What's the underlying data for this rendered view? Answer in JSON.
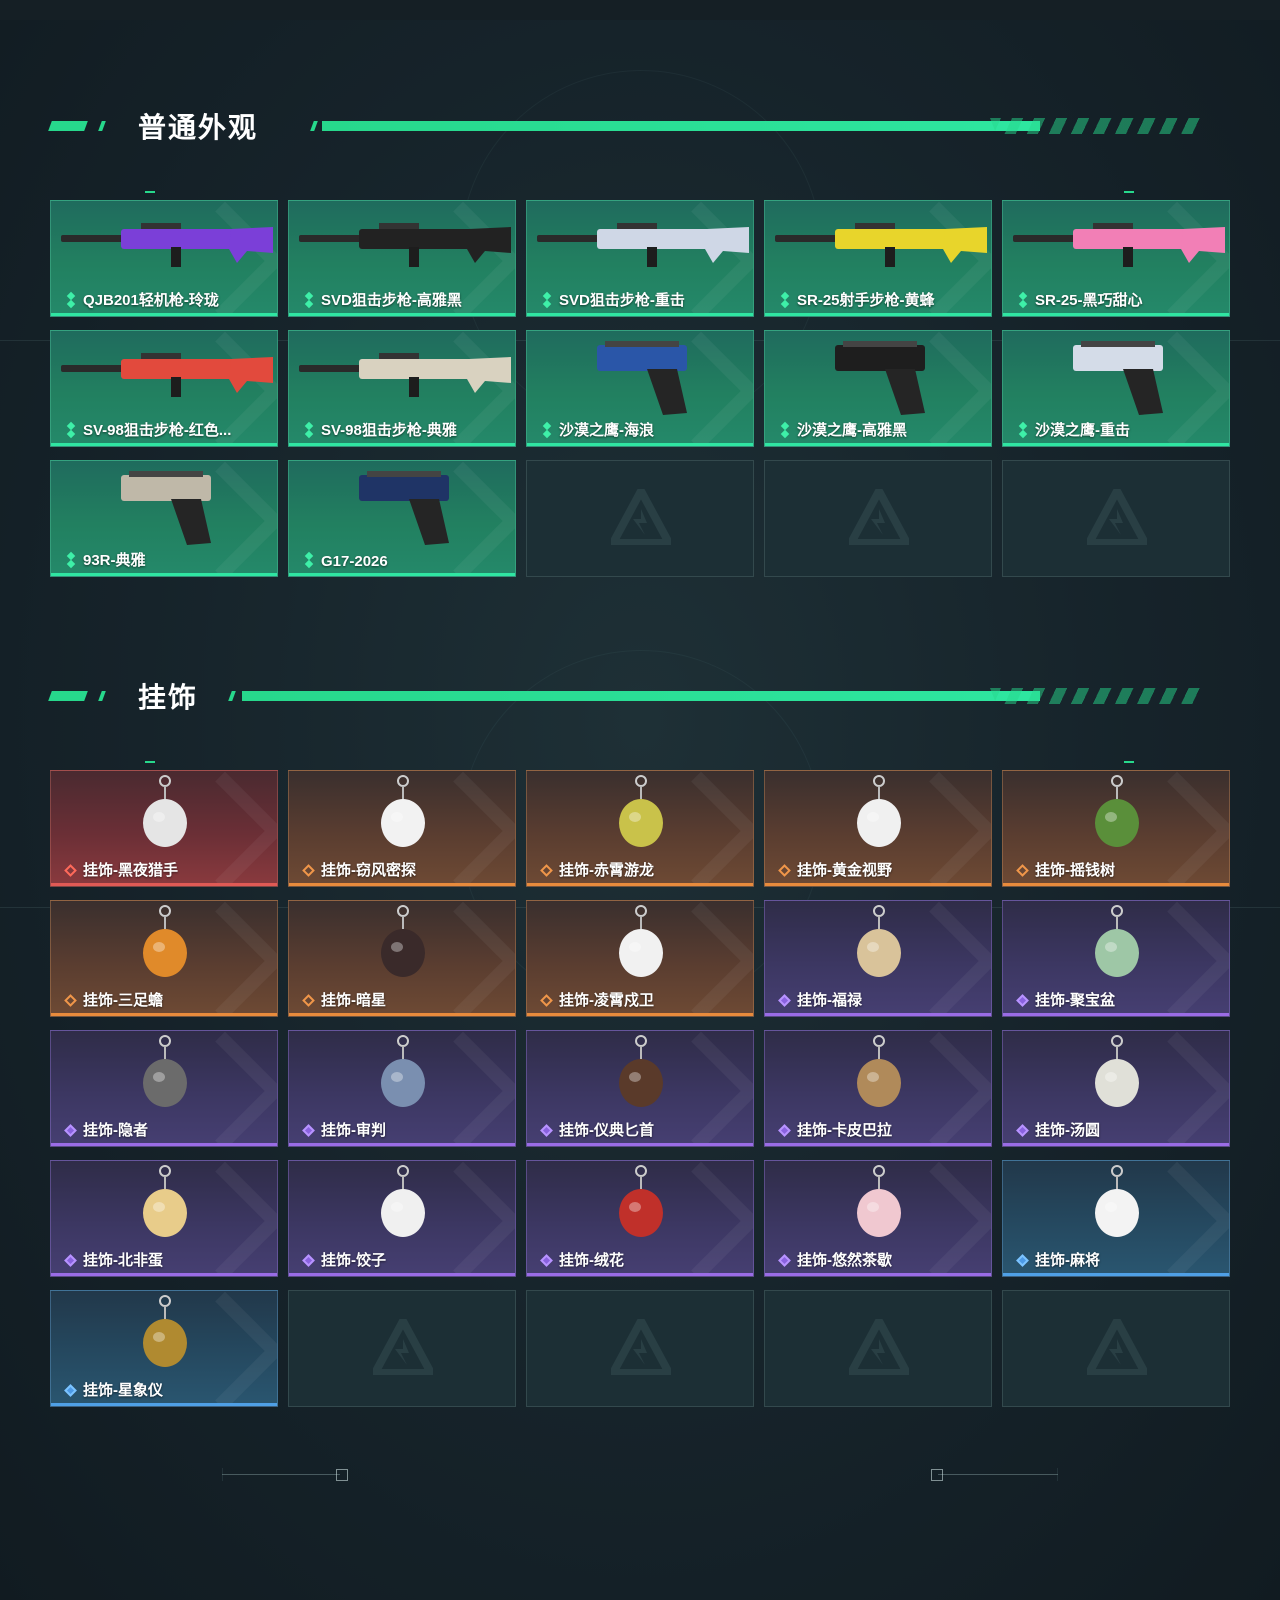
{
  "sections": {
    "skins": {
      "title": "普通外观",
      "items": [
        {
          "label": "QJB201轻机枪-玲珑",
          "icon": "lmg-icon",
          "rarity": "green"
        },
        {
          "label": "SVD狙击步枪-高雅黑",
          "icon": "sniper-rifle-icon",
          "rarity": "green"
        },
        {
          "label": "SVD狙击步枪-重击",
          "icon": "sniper-rifle-icon",
          "rarity": "green"
        },
        {
          "label": "SR-25射手步枪-黄蜂",
          "icon": "marksman-rifle-icon",
          "rarity": "green"
        },
        {
          "label": "SR-25-黑巧甜心",
          "icon": "marksman-rifle-icon",
          "rarity": "green"
        },
        {
          "label": "SV-98狙击步枪-红色...",
          "icon": "sniper-rifle-icon",
          "rarity": "green"
        },
        {
          "label": "SV-98狙击步枪-典雅",
          "icon": "sniper-rifle-icon",
          "rarity": "green"
        },
        {
          "label": "沙漠之鹰-海浪",
          "icon": "pistol-icon",
          "rarity": "green"
        },
        {
          "label": "沙漠之鹰-高雅黑",
          "icon": "pistol-icon",
          "rarity": "green"
        },
        {
          "label": "沙漠之鹰-重击",
          "icon": "pistol-icon",
          "rarity": "green"
        },
        {
          "label": "93R-典雅",
          "icon": "pistol-icon",
          "rarity": "green"
        },
        {
          "label": "G17-2026",
          "icon": "pistol-icon",
          "rarity": "green"
        }
      ]
    },
    "charms": {
      "title": "挂饰",
      "items": [
        {
          "label": "挂饰-黑夜猎手",
          "icon": "charm-icon",
          "rarity": "red"
        },
        {
          "label": "挂饰-窃风密探",
          "icon": "charm-icon",
          "rarity": "orange"
        },
        {
          "label": "挂饰-赤霄游龙",
          "icon": "charm-icon",
          "rarity": "orange"
        },
        {
          "label": "挂饰-黄金视野",
          "icon": "charm-icon",
          "rarity": "orange"
        },
        {
          "label": "挂饰-摇钱树",
          "icon": "charm-icon",
          "rarity": "orange"
        },
        {
          "label": "挂饰-三足蟾",
          "icon": "charm-icon",
          "rarity": "orange"
        },
        {
          "label": "挂饰-暗星",
          "icon": "charm-icon",
          "rarity": "orange"
        },
        {
          "label": "挂饰-凌霄戍卫",
          "icon": "charm-icon",
          "rarity": "orange"
        },
        {
          "label": "挂饰-福禄",
          "icon": "charm-icon",
          "rarity": "purple"
        },
        {
          "label": "挂饰-聚宝盆",
          "icon": "charm-icon",
          "rarity": "purple"
        },
        {
          "label": "挂饰-隐者",
          "icon": "charm-icon",
          "rarity": "purple"
        },
        {
          "label": "挂饰-审判",
          "icon": "charm-icon",
          "rarity": "purple"
        },
        {
          "label": "挂饰-仪典匕首",
          "icon": "charm-icon",
          "rarity": "purple"
        },
        {
          "label": "挂饰-卡皮巴拉",
          "icon": "charm-icon",
          "rarity": "purple"
        },
        {
          "label": "挂饰-汤圆",
          "icon": "charm-icon",
          "rarity": "purple"
        },
        {
          "label": "挂饰-北非蛋",
          "icon": "charm-icon",
          "rarity": "purple"
        },
        {
          "label": "挂饰-饺子",
          "icon": "charm-icon",
          "rarity": "purple"
        },
        {
          "label": "挂饰-绒花",
          "icon": "charm-icon",
          "rarity": "purple"
        },
        {
          "label": "挂饰-悠然茶歇",
          "icon": "charm-icon",
          "rarity": "purple"
        },
        {
          "label": "挂饰-麻将",
          "icon": "charm-icon",
          "rarity": "blue"
        },
        {
          "label": "挂饰-星象仪",
          "icon": "charm-icon",
          "rarity": "blue"
        }
      ]
    }
  },
  "colors": {
    "accent": "#27d88c",
    "green": "#2fe6a2",
    "red": "#e05a55",
    "orange": "#e88b3c",
    "purple": "#9a6ce6",
    "blue": "#4fa0e6"
  }
}
